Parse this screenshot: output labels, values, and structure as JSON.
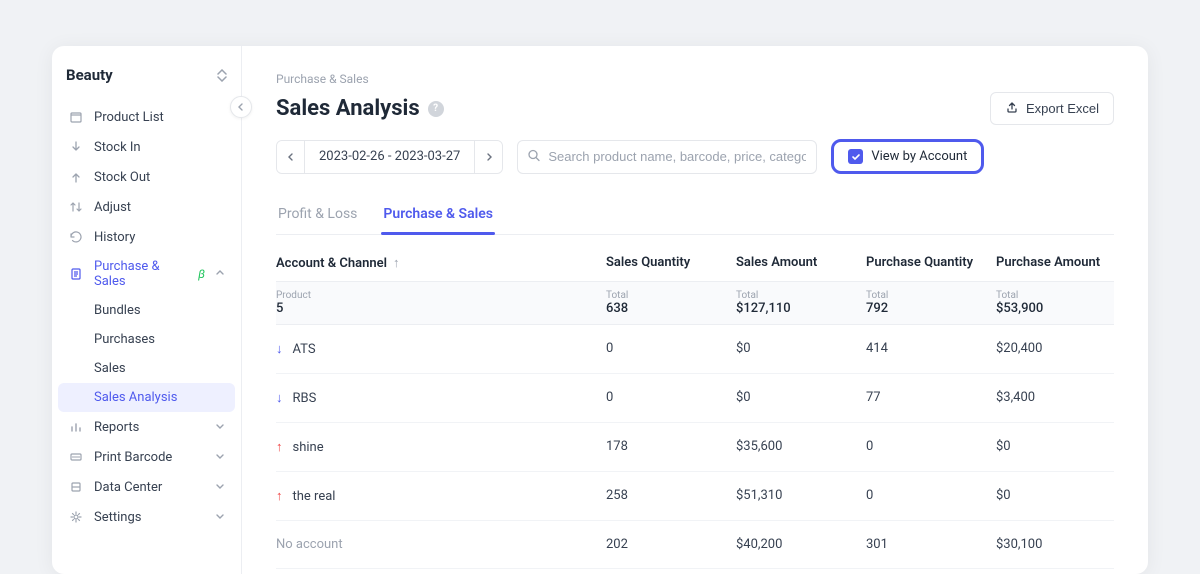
{
  "brand": "Beauty",
  "sidebar": {
    "items": [
      {
        "label": "Product List"
      },
      {
        "label": "Stock In"
      },
      {
        "label": "Stock Out"
      },
      {
        "label": "Adjust"
      },
      {
        "label": "History"
      },
      {
        "label": "Purchase & Sales",
        "beta": "β"
      },
      {
        "label": "Reports"
      },
      {
        "label": "Print Barcode"
      },
      {
        "label": "Data Center"
      },
      {
        "label": "Settings"
      }
    ],
    "subitems": [
      {
        "label": "Bundles"
      },
      {
        "label": "Purchases"
      },
      {
        "label": "Sales"
      },
      {
        "label": "Sales Analysis"
      }
    ]
  },
  "breadcrumb": "Purchase & Sales",
  "page_title": "Sales Analysis",
  "export_label": "Export Excel",
  "date_range": "2023-02-26 - 2023-03-27",
  "search_placeholder": "Search product name, barcode, price, category",
  "view_toggle_label": "View by Account",
  "tabs": [
    {
      "label": "Profit & Loss"
    },
    {
      "label": "Purchase & Sales"
    }
  ],
  "columns": {
    "account": "Account & Channel",
    "sales_qty": "Sales Quantity",
    "sales_amt": "Sales Amount",
    "purch_qty": "Purchase Quantity",
    "purch_amt": "Purchase Amount"
  },
  "totals": {
    "product_label": "Product",
    "product": "5",
    "total_label": "Total",
    "sales_qty": "638",
    "sales_amt": "$127,110",
    "purch_qty": "792",
    "purch_amt": "$53,900"
  },
  "rows": [
    {
      "dir": "down",
      "name": "ATS",
      "sales_qty": "0",
      "sales_amt": "$0",
      "purch_qty": "414",
      "purch_amt": "$20,400"
    },
    {
      "dir": "down",
      "name": "RBS",
      "sales_qty": "0",
      "sales_amt": "$0",
      "purch_qty": "77",
      "purch_amt": "$3,400"
    },
    {
      "dir": "up",
      "name": "shine",
      "sales_qty": "178",
      "sales_amt": "$35,600",
      "purch_qty": "0",
      "purch_amt": "$0"
    },
    {
      "dir": "up",
      "name": "the real",
      "sales_qty": "258",
      "sales_amt": "$51,310",
      "purch_qty": "0",
      "purch_amt": "$0"
    },
    {
      "dir": "none",
      "name": "No account",
      "sales_qty": "202",
      "sales_amt": "$40,200",
      "purch_qty": "301",
      "purch_amt": "$30,100"
    }
  ]
}
